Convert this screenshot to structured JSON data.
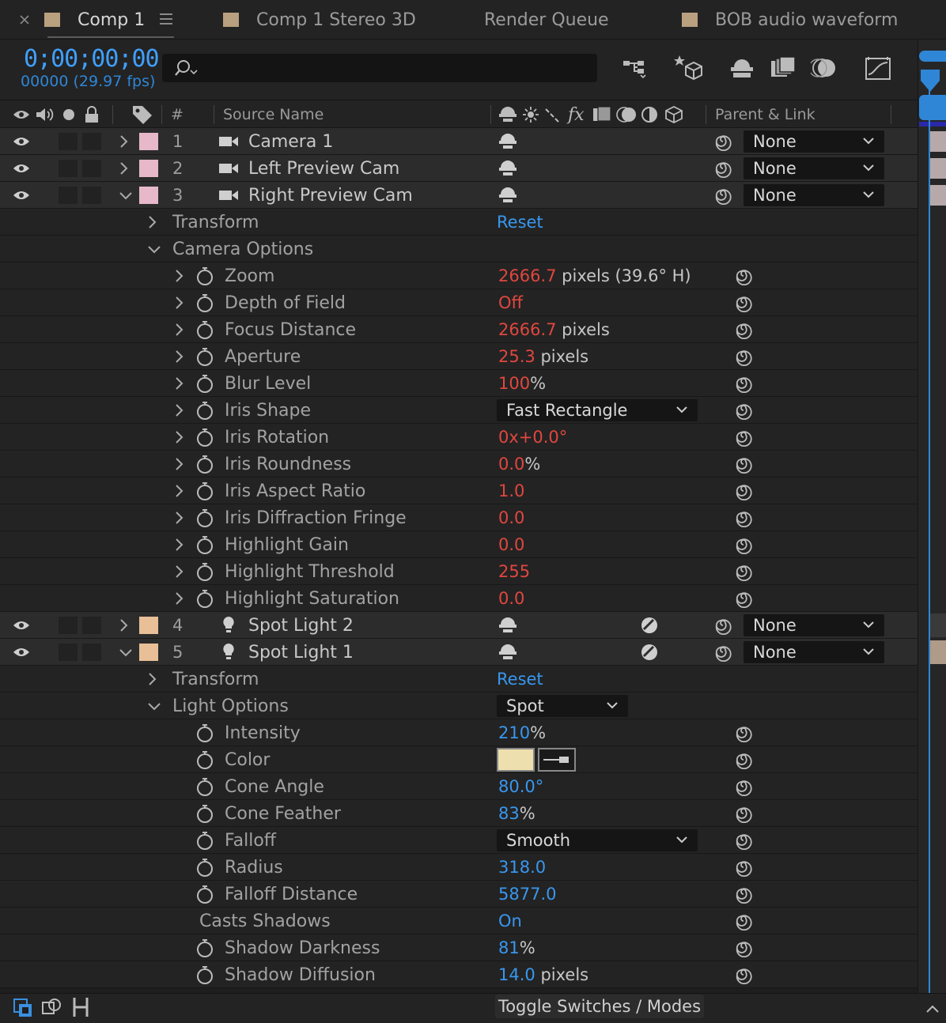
{
  "tabs": [
    {
      "label": "Comp 1",
      "swatch": "#b9a07e",
      "active": true
    },
    {
      "label": "Comp 1 Stereo 3D",
      "swatch": "#b9a07e",
      "active": false
    },
    {
      "label": "Render Queue",
      "swatch": null,
      "active": false
    },
    {
      "label": "BOB audio waveform",
      "swatch": "#b9a07e",
      "active": false
    }
  ],
  "header": {
    "timecode": "0;00;00;00",
    "frames": "00000 (29.97 fps)"
  },
  "columns": {
    "number": "#",
    "source_name": "Source Name",
    "fx": "fx",
    "parent_link": "Parent & Link"
  },
  "layers": {
    "l1": {
      "num": "1",
      "name": "Camera 1",
      "parent": "None",
      "color": "#e6b8c9"
    },
    "l2": {
      "num": "2",
      "name": "Left Preview Cam",
      "parent": "None",
      "color": "#e6b8c9"
    },
    "l3": {
      "num": "3",
      "name": "Right Preview Cam",
      "parent": "None",
      "color": "#e6b8c9"
    },
    "l4": {
      "num": "4",
      "name": "Spot Light 2",
      "parent": "None",
      "color": "#e8bf97"
    },
    "l5": {
      "num": "5",
      "name": "Spot Light 1",
      "parent": "None",
      "color": "#e8bf97"
    }
  },
  "camera": {
    "transform": "Transform",
    "reset": "Reset",
    "options": "Camera Options",
    "zoom": {
      "label": "Zoom",
      "value": "2666.7",
      "unit": "pixels (39.6° H)"
    },
    "dof": {
      "label": "Depth of Field",
      "value": "Off"
    },
    "focus": {
      "label": "Focus Distance",
      "value": "2666.7",
      "unit": "pixels"
    },
    "aperture": {
      "label": "Aperture",
      "value": "25.3",
      "unit": "pixels"
    },
    "blur": {
      "label": "Blur Level",
      "value": "100",
      "unit": "%"
    },
    "iris_shape": {
      "label": "Iris Shape",
      "value": "Fast Rectangle"
    },
    "iris_rot": {
      "label": "Iris Rotation",
      "v1": "0x",
      "v2": "+0.0°"
    },
    "iris_round": {
      "label": "Iris Roundness",
      "value": "0.0",
      "unit": "%"
    },
    "iris_aspect": {
      "label": "Iris Aspect Ratio",
      "value": "1.0"
    },
    "iris_diff": {
      "label": "Iris Diffraction Fringe",
      "value": "0.0"
    },
    "hl_gain": {
      "label": "Highlight Gain",
      "value": "0.0"
    },
    "hl_thresh": {
      "label": "Highlight Threshold",
      "value": "255"
    },
    "hl_sat": {
      "label": "Highlight Saturation",
      "value": "0.0"
    }
  },
  "light": {
    "transform": "Transform",
    "reset": "Reset",
    "options": "Light Options",
    "type": "Spot",
    "intensity": {
      "label": "Intensity",
      "value": "210",
      "unit": "%"
    },
    "color": {
      "label": "Color",
      "swatch": "#eedfae"
    },
    "cone_angle": {
      "label": "Cone Angle",
      "value": "80.0°"
    },
    "cone_feather": {
      "label": "Cone Feather",
      "value": "83",
      "unit": "%"
    },
    "falloff": {
      "label": "Falloff",
      "value": "Smooth"
    },
    "radius": {
      "label": "Radius",
      "value": "318.0"
    },
    "falloff_dist": {
      "label": "Falloff Distance",
      "value": "5877.0"
    },
    "casts": {
      "label": "Casts Shadows",
      "value": "On"
    },
    "shadow_dark": {
      "label": "Shadow Darkness",
      "value": "81",
      "unit": "%"
    },
    "shadow_diff": {
      "label": "Shadow Diffusion",
      "value": "14.0",
      "unit": "pixels"
    }
  },
  "footer": {
    "toggle": "Toggle Switches / Modes"
  },
  "colors": {
    "accent_blue": "#3897ef",
    "value_red": "#e0473f",
    "label_pink": "#e6b8c9",
    "label_peach": "#e8bf97"
  }
}
